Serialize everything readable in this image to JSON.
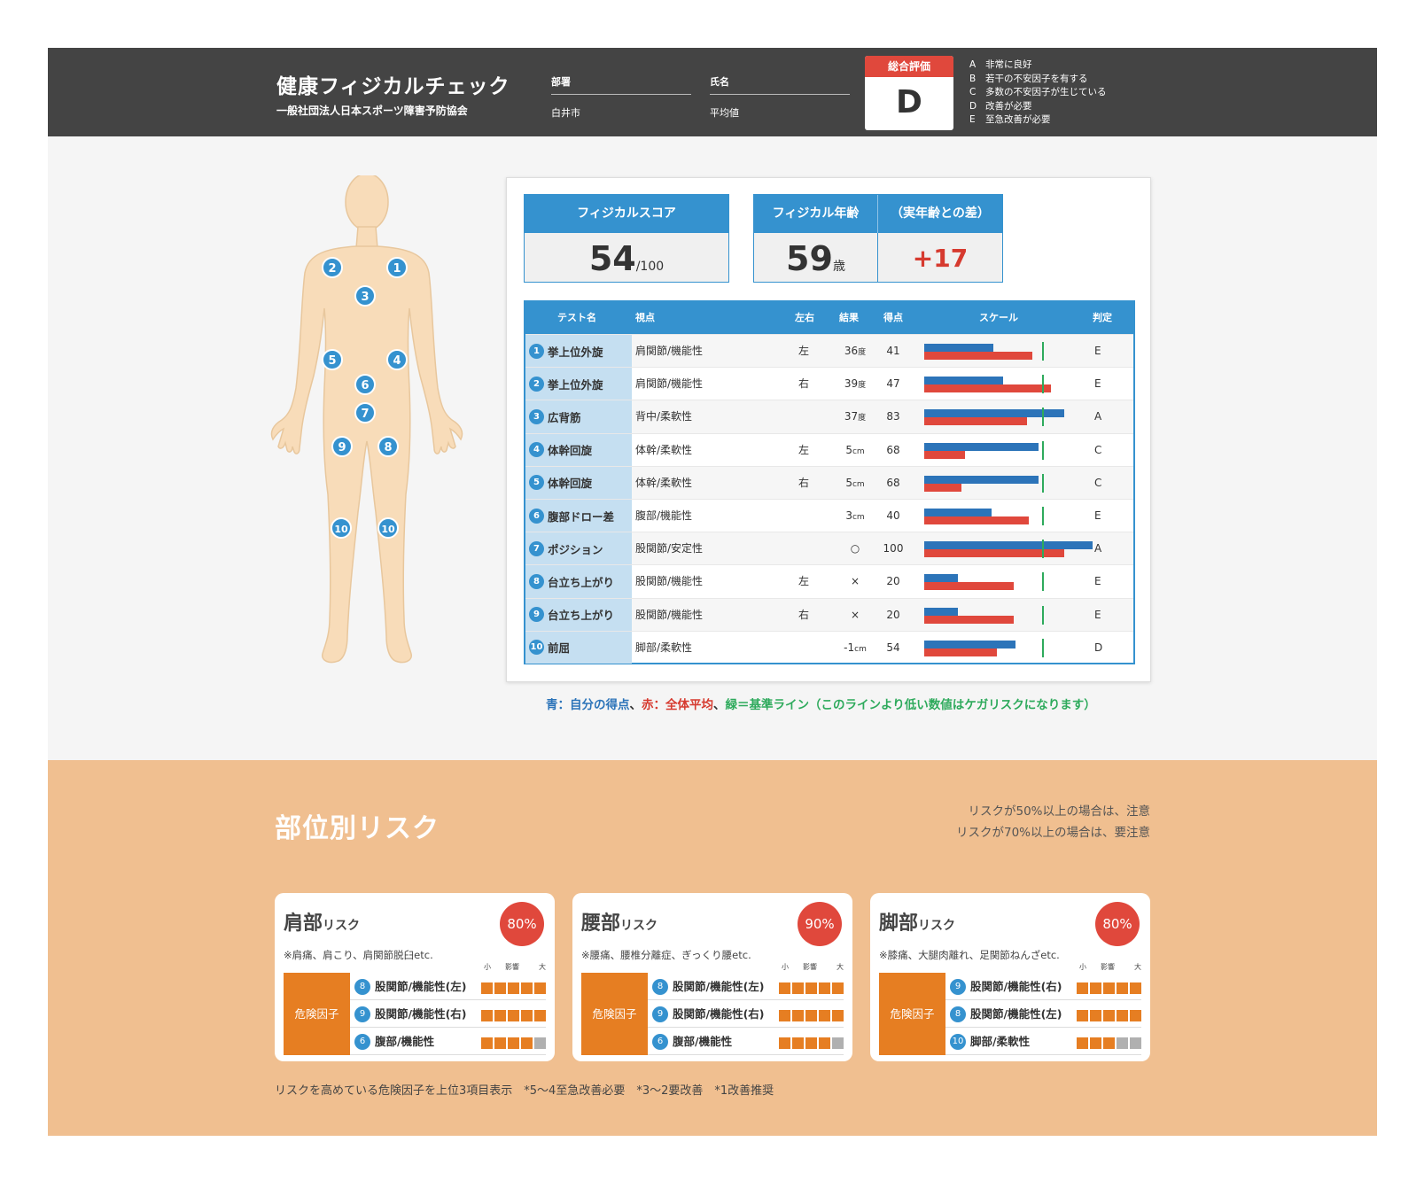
{
  "header": {
    "title": "健康フィジカルチェック",
    "subtitle": "一般社団法人日本スポーツ障害予防協会",
    "dept_label": "部署",
    "dept_value": "白井市",
    "name_label": "氏名",
    "name_value": "平均値",
    "grade_label": "総合評価",
    "grade_value": "D",
    "grade_legend": [
      {
        "k": "A",
        "t": "非常に良好"
      },
      {
        "k": "B",
        "t": "若干の不安因子を有する"
      },
      {
        "k": "C",
        "t": "多数の不安因子が生じている"
      },
      {
        "k": "D",
        "t": "改善が必要"
      },
      {
        "k": "E",
        "t": "至急改善が必要"
      }
    ]
  },
  "stats": {
    "score_label": "フィジカルスコア",
    "score_value": "54",
    "score_max": "/100",
    "age_label": "フィジカル年齢",
    "age_value": "59",
    "age_unit": "歳",
    "diff_label": "（実年齢との差）",
    "diff_value": "+17"
  },
  "table": {
    "headers": {
      "name": "テスト名",
      "view": "視点",
      "side": "左右",
      "result": "結果",
      "score": "得点",
      "scale": "スケール",
      "judge": "判定"
    },
    "rows": [
      {
        "no": "1",
        "name": "挙上位外旋",
        "view": "肩関節/機能性",
        "side": "左",
        "result": "36",
        "unit": "度",
        "score": "41",
        "judge": "E",
        "self": 41,
        "avg": 64
      },
      {
        "no": "2",
        "name": "挙上位外旋",
        "view": "肩関節/機能性",
        "side": "右",
        "result": "39",
        "unit": "度",
        "score": "47",
        "judge": "E",
        "self": 47,
        "avg": 75
      },
      {
        "no": "3",
        "name": "広背筋",
        "view": "背中/柔軟性",
        "side": "",
        "result": "37",
        "unit": "度",
        "score": "83",
        "judge": "A",
        "self": 83,
        "avg": 61
      },
      {
        "no": "4",
        "name": "体幹回旋",
        "view": "体幹/柔軟性",
        "side": "左",
        "result": "5",
        "unit": "cm",
        "score": "68",
        "judge": "C",
        "self": 68,
        "avg": 24
      },
      {
        "no": "5",
        "name": "体幹回旋",
        "view": "体幹/柔軟性",
        "side": "右",
        "result": "5",
        "unit": "cm",
        "score": "68",
        "judge": "C",
        "self": 68,
        "avg": 22
      },
      {
        "no": "6",
        "name": "腹部ドロー差",
        "view": "腹部/機能性",
        "side": "",
        "result": "3",
        "unit": "cm",
        "score": "40",
        "judge": "E",
        "self": 40,
        "avg": 62
      },
      {
        "no": "7",
        "name": "ポジション",
        "view": "股関節/安定性",
        "side": "",
        "result": "○",
        "unit": "",
        "score": "100",
        "judge": "A",
        "self": 100,
        "avg": 83
      },
      {
        "no": "8",
        "name": "台立ち上がり",
        "view": "股関節/機能性",
        "side": "左",
        "result": "×",
        "unit": "",
        "score": "20",
        "judge": "E",
        "self": 20,
        "avg": 53
      },
      {
        "no": "9",
        "name": "台立ち上がり",
        "view": "股関節/機能性",
        "side": "右",
        "result": "×",
        "unit": "",
        "score": "20",
        "judge": "E",
        "self": 20,
        "avg": 53
      },
      {
        "no": "10",
        "name": "前屈",
        "view": "脚部/柔軟性",
        "side": "",
        "result": "-1",
        "unit": "cm",
        "score": "54",
        "judge": "D",
        "self": 54,
        "avg": 43
      }
    ],
    "baseline": 70,
    "scale_max": 100
  },
  "legend_note": {
    "blue_label": "青：自分の得点",
    "sep1": "、",
    "red_label": "赤：全体平均",
    "sep2": "、",
    "green_label": "緑＝基準ライン（このラインより低い数値はケガリスクになります）",
    "blue_color": "#2c74b9",
    "red_color": "#d63a2f",
    "green_color": "#2eaa5c"
  },
  "figure_pins": [
    "1",
    "2",
    "3",
    "4",
    "5",
    "6",
    "7",
    "8",
    "9",
    "10",
    "10"
  ],
  "risk": {
    "title": "部位別リスク",
    "note1": "リスクが50%以上の場合は、注意",
    "note2": "リスクが70%以上の場合は、要注意",
    "cards": [
      {
        "title": "肩部",
        "suffix": "リスク",
        "pct": "80%",
        "desc": "※肩痛、肩こり、肩関節脱臼etc.",
        "items": [
          {
            "no": "8",
            "label": "股関節/機能性(左)",
            "level": 5
          },
          {
            "no": "9",
            "label": "股関節/機能性(右)",
            "level": 5
          },
          {
            "no": "6",
            "label": "腹部/機能性",
            "level": 4
          }
        ]
      },
      {
        "title": "腰部",
        "suffix": "リスク",
        "pct": "90%",
        "desc": "※腰痛、腰椎分離症、ぎっくり腰etc.",
        "items": [
          {
            "no": "8",
            "label": "股関節/機能性(左)",
            "level": 5
          },
          {
            "no": "9",
            "label": "股関節/機能性(右)",
            "level": 5
          },
          {
            "no": "6",
            "label": "腹部/機能性",
            "level": 4
          }
        ]
      },
      {
        "title": "脚部",
        "suffix": "リスク",
        "pct": "80%",
        "desc": "※膝痛、大腿肉離れ、足関節ねんざetc.",
        "items": [
          {
            "no": "9",
            "label": "股関節/機能性(右)",
            "level": 5
          },
          {
            "no": "8",
            "label": "股関節/機能性(左)",
            "level": 5
          },
          {
            "no": "10",
            "label": "脚部/柔軟性",
            "level": 3
          }
        ]
      }
    ],
    "danger_label": "危険因子",
    "scale_small": "小",
    "scale_mid": "影響",
    "scale_large": "大",
    "footer": "リスクを高めている危険因子を上位3項目表示　*5〜4至急改善必要　*3〜2要改善　*1改善推奨"
  }
}
